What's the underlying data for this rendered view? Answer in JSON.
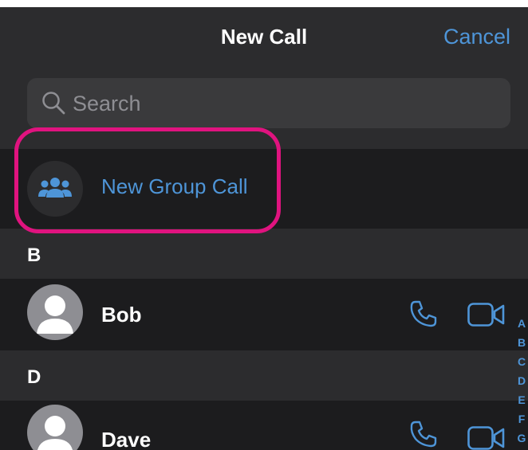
{
  "header": {
    "title": "New Call",
    "cancel_label": "Cancel"
  },
  "search": {
    "placeholder": "Search",
    "value": ""
  },
  "group_call": {
    "label": "New Group Call"
  },
  "sections": [
    {
      "letter": "B",
      "contacts": [
        {
          "name": "Bob"
        }
      ]
    },
    {
      "letter": "D",
      "contacts": [
        {
          "name": "Dave"
        }
      ]
    }
  ],
  "alphabet_index": [
    "A",
    "B",
    "C",
    "D",
    "E",
    "F",
    "G"
  ],
  "colors": {
    "accent": "#4e95d8",
    "highlight": "#e0137f",
    "background": "#1c1c1e",
    "header": "#2c2c2e"
  }
}
